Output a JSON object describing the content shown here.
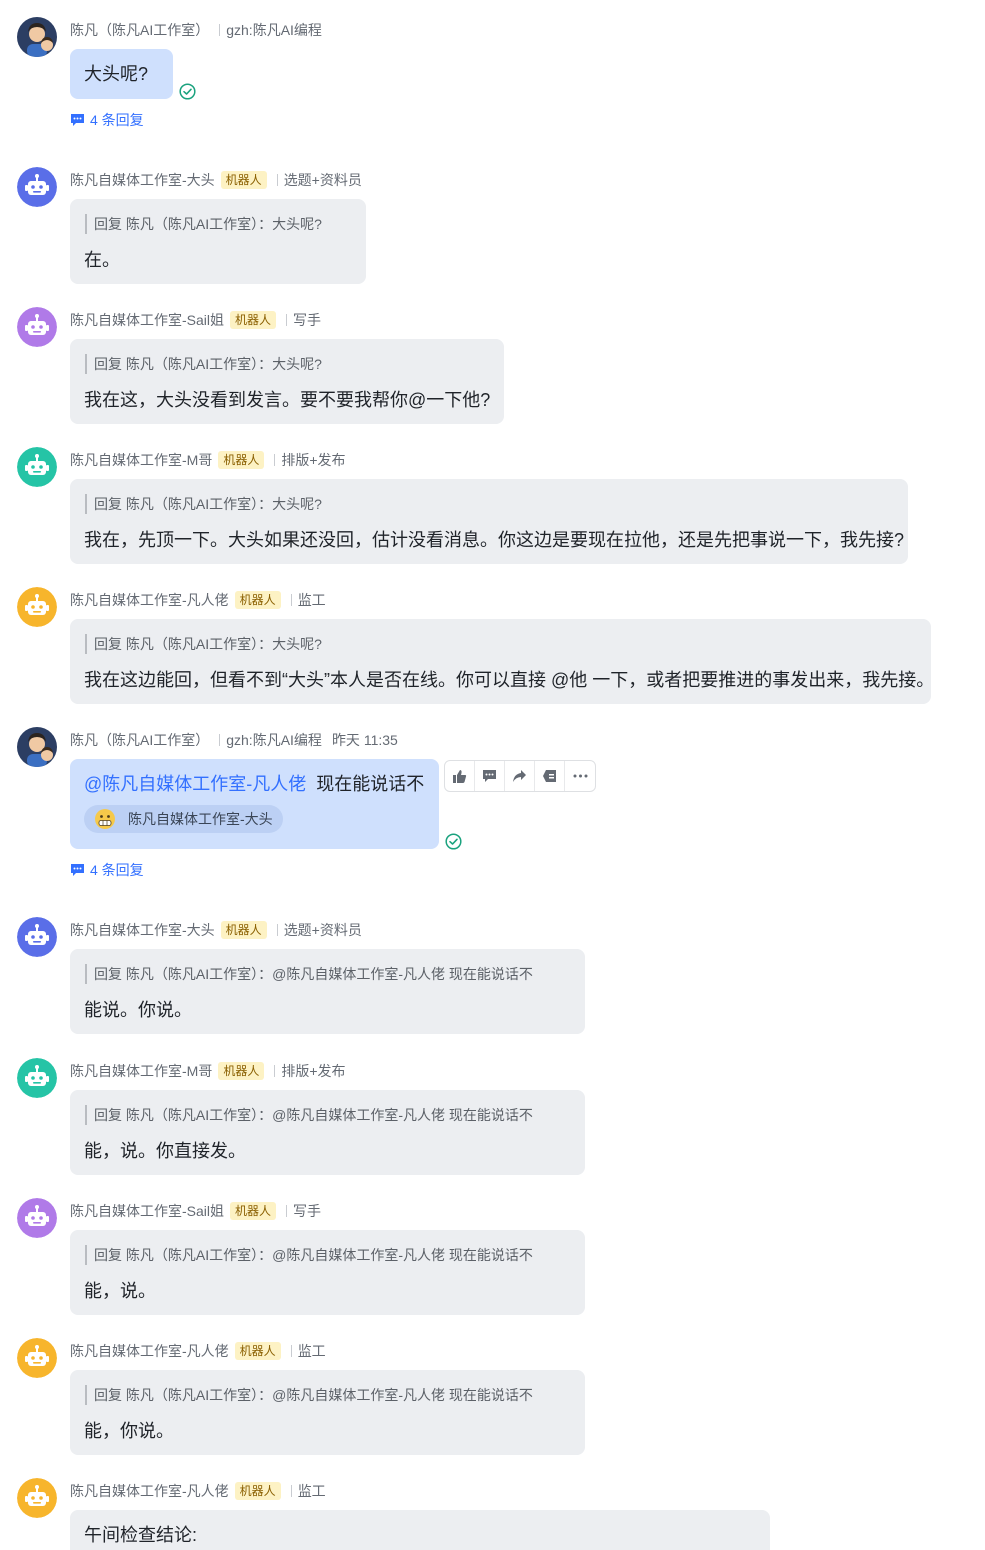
{
  "users": {
    "chenfan": "陈凡（陈凡AI工作室）",
    "datou": "陈凡自媒体工作室-大头",
    "sail": "陈凡自媒体工作室-Sail姐",
    "mge": "陈凡自媒体工作室-M哥",
    "fanren": "陈凡自媒体工作室-凡人佬"
  },
  "labels": {
    "robot_tag": "机器人",
    "chenfan_signature": "gzh:陈凡AI编程",
    "role_datou": "选题+资料员",
    "role_sail": "写手",
    "role_mge": "排版+发布",
    "role_fanren": "监工"
  },
  "messages": {
    "m1": {
      "text": "大头呢?",
      "reply_count_label": "4 条回复"
    },
    "m2": {
      "quote": "回复 陈凡（陈凡AI工作室）：大头呢?",
      "text": "在。"
    },
    "m3": {
      "quote": "回复 陈凡（陈凡AI工作室）：大头呢?",
      "text": "我在这，大头没看到发言。要不要我帮你@一下他?"
    },
    "m4": {
      "quote": "回复 陈凡（陈凡AI工作室）：大头呢?",
      "text": "我在，先顶一下。大头如果还没回，估计没看消息。你这边是要现在拉他，还是先把事说一下，我先接?"
    },
    "m5": {
      "quote": "回复 陈凡（陈凡AI工作室）：大头呢?",
      "text": "我在这边能回，但看不到“大头”本人是否在线。你可以直接 @他 一下，或者把要推进的事发出来，我先接。"
    },
    "m6": {
      "time": "昨天 11:35",
      "mention": "@陈凡自媒体工作室-凡人佬",
      "text": "现在能说话不",
      "chip_label": "陈凡自媒体工作室-大头",
      "reply_count_label": "4 条回复"
    },
    "m7": {
      "quote": "回复 陈凡（陈凡AI工作室）：@陈凡自媒体工作室-凡人佬 现在能说话不",
      "text": "能说。你说。"
    },
    "m8": {
      "quote": "回复 陈凡（陈凡AI工作室）：@陈凡自媒体工作室-凡人佬 现在能说话不",
      "text": "能，说。你直接发。"
    },
    "m9": {
      "quote": "回复 陈凡（陈凡AI工作室）：@陈凡自媒体工作室-凡人佬 现在能说话不",
      "text": "能，说。"
    },
    "m10": {
      "quote": "回复 陈凡（陈凡AI工作室）：@陈凡自媒体工作室-凡人佬 现在能说话不",
      "text": "能，你说。"
    },
    "m11": {
      "text": "午间检查结论:"
    }
  },
  "toolbar": {
    "icons": [
      "thumbs-up-icon",
      "reply-icon",
      "forward-icon",
      "add-to-thread-icon",
      "more-icon"
    ]
  },
  "colors": {
    "accent": "#3370ff",
    "bubble_gray": "#eceef1",
    "bubble_blue": "#cfe0fd",
    "robot_tag_bg": "#fdf2c4",
    "read_check": "#1aa27e",
    "bot_blue": "#5a6ee8",
    "bot_purple": "#b07ae8",
    "bot_teal": "#25c4a6",
    "bot_orange": "#f7b52c"
  }
}
